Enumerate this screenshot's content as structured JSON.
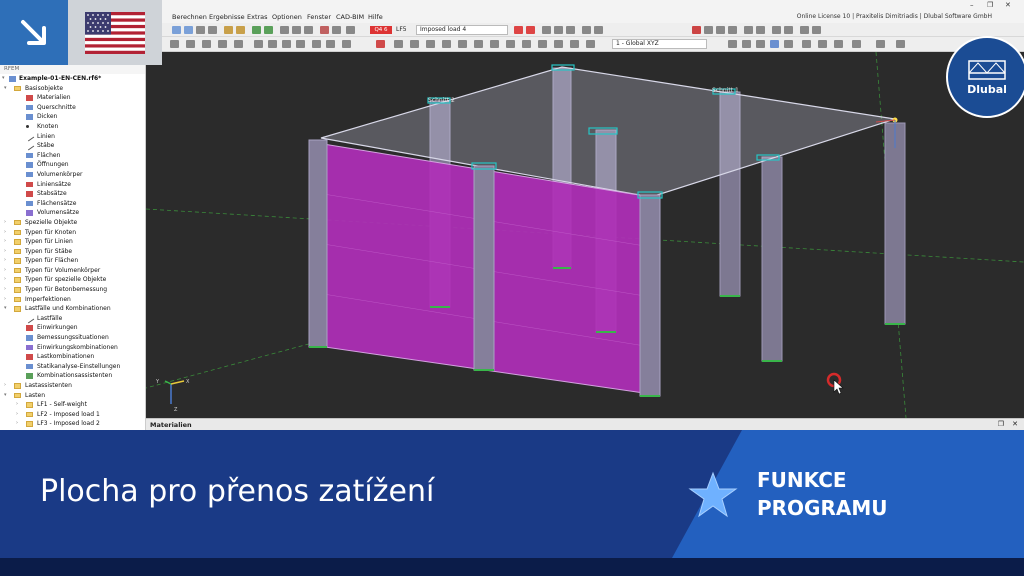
{
  "window": {
    "license_text": "Online License 10 | Praxitelis Dimitriadis | Dlubal Software GmbH",
    "minimize": "–",
    "maximize": "❐",
    "close": "✕"
  },
  "menu": {
    "items": [
      "Berechnen",
      "Ergebnisse",
      "Extras",
      "Optionen",
      "Fenster",
      "CAD-BIM",
      "Hilfe"
    ]
  },
  "toolbar": {
    "load_case_badge": "Q4 6",
    "load_case_code": "LF5",
    "load_case_name": "Imposed load 4",
    "coordinate_system": "1 - Global XYZ"
  },
  "navigator": {
    "header": "RFEM",
    "file": "Example-01-EN-CEN.rf6*",
    "items": [
      {
        "label": "Basisobjekte",
        "level": 1,
        "icon": "folder",
        "open": true
      },
      {
        "label": "Materialien",
        "level": 2,
        "icon": "material-icon"
      },
      {
        "label": "Querschnitte",
        "level": 2,
        "icon": "section-icon"
      },
      {
        "label": "Dicken",
        "level": 2,
        "icon": "thickness-icon"
      },
      {
        "label": "Knoten",
        "level": 2,
        "icon": "node-icon"
      },
      {
        "label": "Linien",
        "level": 2,
        "icon": "line-icon"
      },
      {
        "label": "Stäbe",
        "level": 2,
        "icon": "member-icon"
      },
      {
        "label": "Flächen",
        "level": 2,
        "icon": "surface-icon"
      },
      {
        "label": "Öffnungen",
        "level": 2,
        "icon": "opening-icon"
      },
      {
        "label": "Volumenkörper",
        "level": 2,
        "icon": "solid-icon"
      },
      {
        "label": "Liniensätze",
        "level": 2,
        "icon": "lineset-icon"
      },
      {
        "label": "Stabsätze",
        "level": 2,
        "icon": "memberset-icon"
      },
      {
        "label": "Flächensätze",
        "level": 2,
        "icon": "surfaceset-icon"
      },
      {
        "label": "Volumensätze",
        "level": 2,
        "icon": "solidset-icon"
      },
      {
        "label": "Spezielle Objekte",
        "level": 1,
        "icon": "folder"
      },
      {
        "label": "Typen für Knoten",
        "level": 1,
        "icon": "folder"
      },
      {
        "label": "Typen für Linien",
        "level": 1,
        "icon": "folder"
      },
      {
        "label": "Typen für Stäbe",
        "level": 1,
        "icon": "folder"
      },
      {
        "label": "Typen für Flächen",
        "level": 1,
        "icon": "folder"
      },
      {
        "label": "Typen für Volumenkörper",
        "level": 1,
        "icon": "folder"
      },
      {
        "label": "Typen für spezielle Objekte",
        "level": 1,
        "icon": "folder"
      },
      {
        "label": "Typen für Betonbemessung",
        "level": 1,
        "icon": "folder"
      },
      {
        "label": "Imperfektionen",
        "level": 1,
        "icon": "folder"
      },
      {
        "label": "Lastfälle und Kombinationen",
        "level": 1,
        "icon": "folder",
        "open": true
      },
      {
        "label": "Lastfälle",
        "level": 2,
        "icon": "loadcase-icon"
      },
      {
        "label": "Einwirkungen",
        "level": 2,
        "icon": "action-icon"
      },
      {
        "label": "Bemessungssituationen",
        "level": 2,
        "icon": "design-situation-icon"
      },
      {
        "label": "Einwirkungskombinationen",
        "level": 2,
        "icon": "action-combination-icon"
      },
      {
        "label": "Lastkombinationen",
        "level": 2,
        "icon": "load-combination-icon"
      },
      {
        "label": "Statikanalyse-Einstellungen",
        "level": 2,
        "icon": "analysis-settings-icon"
      },
      {
        "label": "Kombinationsassistenten",
        "level": 2,
        "icon": "combination-wizard-icon"
      },
      {
        "label": "Lastassistenten",
        "level": 1,
        "icon": "folder"
      },
      {
        "label": "Lasten",
        "level": 1,
        "icon": "folder",
        "open": true
      },
      {
        "label": "LF1 - Self-weight",
        "level": 2,
        "icon": "folder"
      },
      {
        "label": "LF2 - Imposed load 1",
        "level": 2,
        "icon": "folder"
      },
      {
        "label": "LF3 - Imposed load 2",
        "level": 2,
        "icon": "folder"
      }
    ]
  },
  "viewport": {
    "section_labels": [
      "Schnitt 2",
      "Schnitt 1"
    ],
    "axis_labels": [
      "Y",
      "X",
      "Z"
    ]
  },
  "panel": {
    "title": "Materialien"
  },
  "brand": {
    "name": "Dlubal"
  },
  "banner": {
    "title": "Plocha pro přenos zatížení",
    "tag_line1": "FUNKCE",
    "tag_line2": "PROGRAMU"
  },
  "colors": {
    "banner_dark": "#0b1c49",
    "banner_mid": "#1a3a86",
    "banner_accent": "#2360bf",
    "surface_magenta": "#b02fb8",
    "viewport_bg": "#2b2b2b",
    "brand_blue": "#1b4c94"
  }
}
